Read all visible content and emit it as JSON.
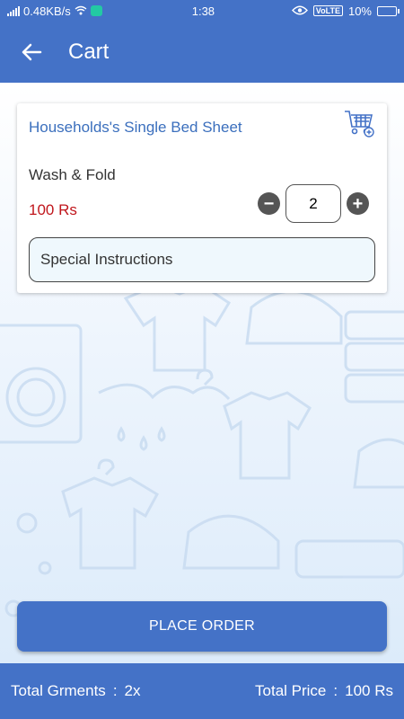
{
  "status_bar": {
    "network_speed": "0.48KB/s",
    "time": "1:38",
    "volte": "VoLTE",
    "battery": "10%"
  },
  "header": {
    "title": "Cart",
    "back_icon": "arrow-left-icon"
  },
  "cart_item": {
    "name": "Households's Single Bed Sheet",
    "service": "Wash & Fold",
    "price": "100 Rs",
    "quantity": "2",
    "decrement_label": "−",
    "increment_label": "+",
    "instructions_placeholder": "Special Instructions",
    "cart_icon": "cart-icon"
  },
  "actions": {
    "place_order_label": "PLACE ORDER"
  },
  "footer": {
    "garments_label": "Total Grments",
    "garments_value": "2x",
    "price_label": "Total Price",
    "price_value": "100 Rs",
    "separator": ":"
  },
  "colors": {
    "primary": "#4472c7",
    "price": "#c0161c",
    "item_name": "#3b6fbd"
  }
}
